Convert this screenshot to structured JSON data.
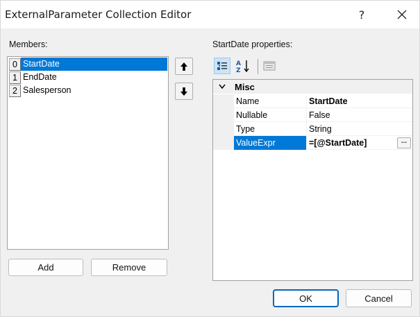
{
  "window": {
    "title": "ExternalParameter Collection Editor",
    "help_label": "?",
    "close_icon": "close-icon"
  },
  "members": {
    "label": "Members:",
    "items": [
      {
        "index": "0",
        "name": "StartDate",
        "selected": true
      },
      {
        "index": "1",
        "name": "EndDate",
        "selected": false
      },
      {
        "index": "2",
        "name": "Salesperson",
        "selected": false
      }
    ],
    "add_label": "Add",
    "remove_label": "Remove"
  },
  "properties": {
    "label": "StartDate properties:",
    "toolbar": [
      "categorized-icon",
      "alphabetical-sort-icon",
      "property-pages-icon"
    ],
    "category": "Misc",
    "rows": [
      {
        "name": "Name",
        "value": "StartDate",
        "bold": true
      },
      {
        "name": "Nullable",
        "value": "False",
        "bold": false
      },
      {
        "name": "Type",
        "value": "String",
        "bold": false
      },
      {
        "name": "ValueExpr",
        "value": "=[@StartDate]",
        "bold": true,
        "selected": true,
        "has_button": true,
        "button_label": "..."
      }
    ]
  },
  "footer": {
    "ok_label": "OK",
    "cancel_label": "Cancel"
  },
  "colors": {
    "selection": "#0078d7",
    "dialog_bg": "#f0f0f0",
    "accent_border": "#0067c0"
  }
}
